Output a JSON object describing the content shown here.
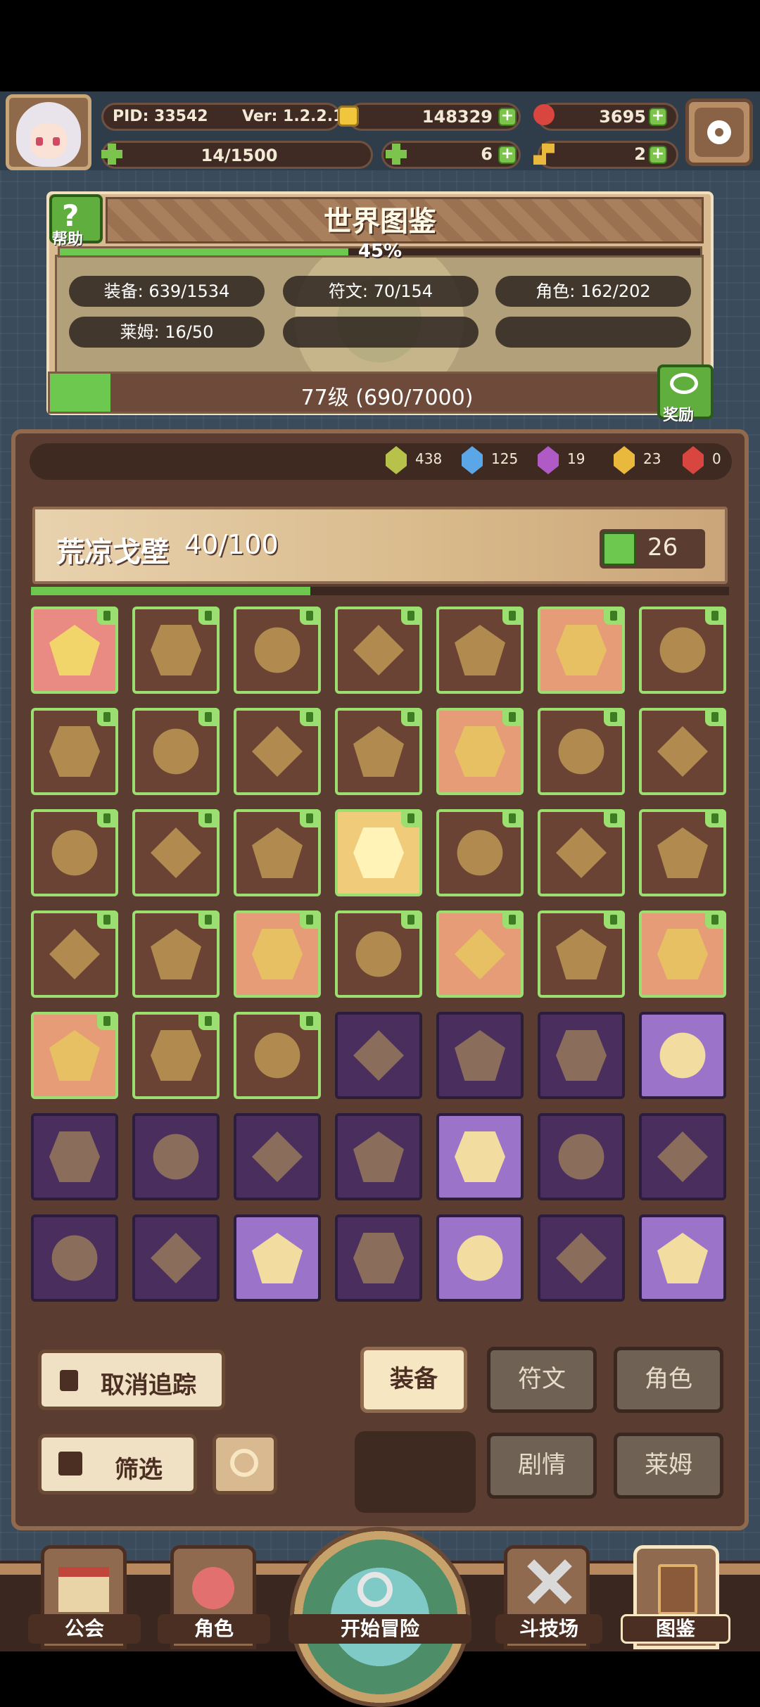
{
  "hud": {
    "pid": "PID: 33542",
    "version": "Ver: 1.2.2.1",
    "gold": "148329",
    "gems": "3695",
    "stamina": "14/1500",
    "clover": "6",
    "tickets": "2"
  },
  "codex": {
    "title": "世界图鉴",
    "help_label": "帮助",
    "percent": "45%",
    "percent_value": 45,
    "stats": {
      "equipment": "装备: 639/1534",
      "runes": "符文: 70/154",
      "characters": "角色: 162/202",
      "slime": "莱姆: 16/50"
    },
    "level_text": "77级 (690/7000)",
    "level_progress": 0.0986,
    "reward_label": "奖励"
  },
  "crystals": [
    {
      "value": "438",
      "color": "#b7c24a"
    },
    {
      "value": "125",
      "color": "#5aa6e6"
    },
    {
      "value": "19",
      "color": "#b05ac6"
    },
    {
      "value": "23",
      "color": "#e8b93c"
    },
    {
      "value": "0",
      "color": "#d9453f"
    }
  ],
  "area": {
    "title": "荒凉戈壁",
    "progress": "40/100",
    "progress_value": 0.4,
    "likes": "26"
  },
  "grid": [
    [
      "pink",
      "brown",
      "brown",
      "brown",
      "brown",
      "orange",
      "brown"
    ],
    [
      "brown",
      "brown",
      "brown",
      "brown",
      "orange",
      "brown",
      "brown"
    ],
    [
      "brown",
      "brown",
      "brown",
      "gold",
      "brown",
      "brown",
      "brown"
    ],
    [
      "brown",
      "brown",
      "orange",
      "brown",
      "orange",
      "brown",
      "orange"
    ],
    [
      "orange",
      "brown",
      "brown",
      "purple",
      "purple",
      "purple",
      "lilac"
    ],
    [
      "purple",
      "purple",
      "purple",
      "purple",
      "lilac",
      "purple",
      "purple"
    ],
    [
      "purple",
      "purple",
      "lilac",
      "purple",
      "lilac",
      "purple",
      "lilac"
    ]
  ],
  "controls": {
    "untrack": "取消追踪",
    "filter": "筛选",
    "equipment": "装备",
    "runes": "符文",
    "characters": "角色",
    "story": "剧情",
    "slime": "莱姆"
  },
  "tabs": {
    "guild": "公会",
    "character": "角色",
    "adventure": "开始冒险",
    "arena": "斗技场",
    "codex": "图鉴"
  }
}
